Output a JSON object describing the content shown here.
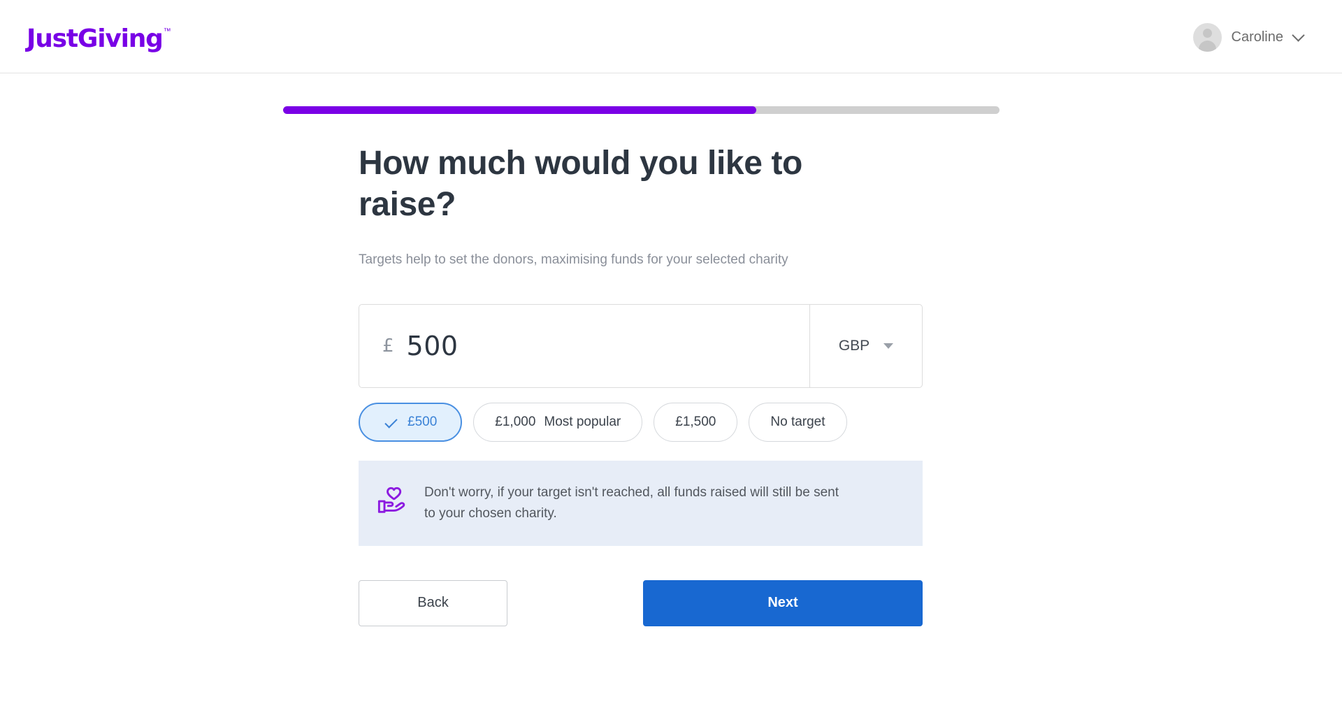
{
  "header": {
    "logo_text": "JustGiving",
    "logo_tm": "™",
    "account_name": "Caroline",
    "brand_color": "#7800e6"
  },
  "progress": {
    "percent": 66,
    "fill_color": "#7a00e6",
    "track_color": "#cfcfcf"
  },
  "main": {
    "title": "How much would you like to raise?",
    "subtitle": "Targets help to set the donors, maximising funds for your selected charity",
    "amount": {
      "currency_symbol": "£",
      "value": "500",
      "currency_code": "GBP"
    },
    "presets": [
      {
        "label": "£500",
        "sub": "",
        "selected": true
      },
      {
        "label": "£1,000",
        "sub": "Most popular",
        "selected": false
      },
      {
        "label": "£1,500",
        "sub": "",
        "selected": false
      },
      {
        "label": "No target",
        "sub": "",
        "selected": false
      }
    ],
    "info_banner": {
      "text": "Don't worry, if your target isn't reached, all funds raised will still be sent to your chosen charity.",
      "background_color": "#e7edf7",
      "icon_color": "#8c1ae0"
    },
    "actions": {
      "back_label": "Back",
      "next_label": "Next",
      "next_color": "#1868d1"
    }
  }
}
